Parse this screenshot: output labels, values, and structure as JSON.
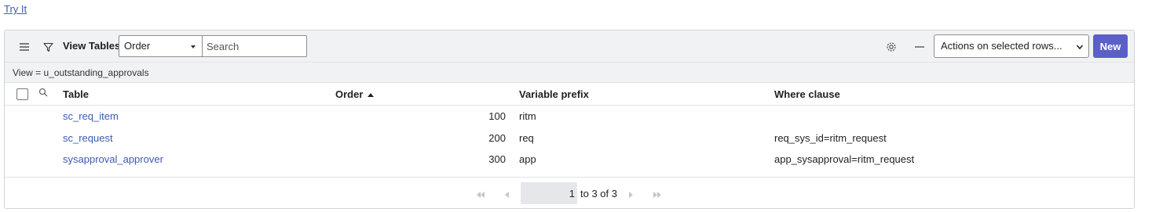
{
  "try_it": "Try It",
  "toolbar": {
    "title": "View Tables",
    "order_select": "Order",
    "search_placeholder": "Search",
    "actions_select": "Actions on selected rows...",
    "new_label": "New"
  },
  "breadcrumb": "View = u_outstanding_approvals",
  "columns": {
    "table": "Table",
    "order": "Order",
    "prefix": "Variable prefix",
    "where": "Where clause"
  },
  "rows": [
    {
      "table": "sc_req_item",
      "order": "100",
      "prefix": "ritm",
      "where": ""
    },
    {
      "table": "sc_request",
      "order": "200",
      "prefix": "req",
      "where": "req_sys_id=ritm_request"
    },
    {
      "table": "sysapproval_approver",
      "order": "300",
      "prefix": "app",
      "where": "app_sysapproval=ritm_request"
    }
  ],
  "pagination": {
    "current": "1",
    "range": "to 3 of 3"
  },
  "colors": {
    "accent": "#5b5fc7",
    "link": "#3b5bb0",
    "toolbar_bg": "#f1f2f4"
  }
}
